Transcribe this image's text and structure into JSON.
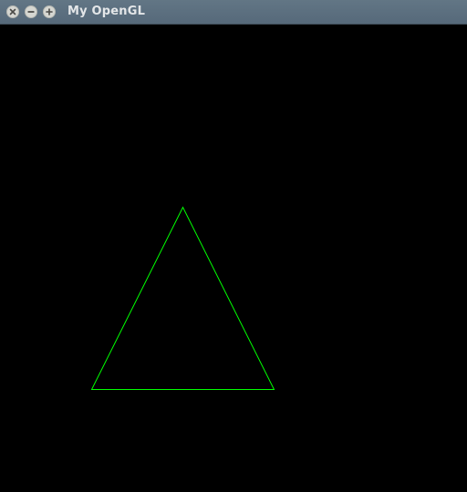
{
  "window": {
    "title": "My OpenGL"
  },
  "titlebar_buttons": [
    {
      "name": "close",
      "icon": "close-icon"
    },
    {
      "name": "minimize",
      "icon": "minimize-icon"
    },
    {
      "name": "maximize",
      "icon": "maximize-icon"
    }
  ],
  "scene": {
    "background_color": "#000000",
    "shape": "triangle",
    "render_mode": "wireframe",
    "stroke_color": "#00ff00"
  },
  "colors": {
    "titlebar": "#5b6e7e",
    "title_text": "#e3e6e8",
    "button_face": "#d6d7d2"
  }
}
